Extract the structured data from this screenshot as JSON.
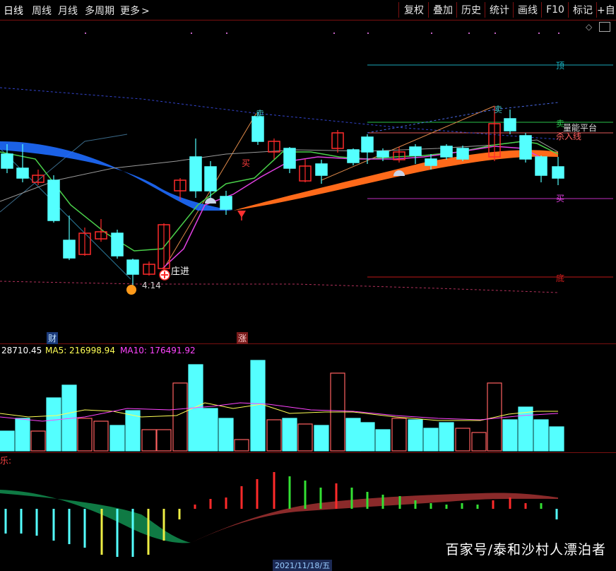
{
  "toolbar": {
    "tabs": [
      "日线",
      "周线",
      "月线",
      "多周期",
      "更多"
    ],
    "more_chevron": ">",
    "buttons": [
      "复权",
      "叠加",
      "历史",
      "统计",
      "画线",
      "F10",
      "标记",
      "+自"
    ]
  },
  "price_panel": {
    "labels": {
      "top": "顶",
      "bottom": "底",
      "sell": "卖",
      "buy": "买",
      "buy_left": "买",
      "sell_top": "卖",
      "platform": "量能平台",
      "kill_line": "杀入线",
      "low_price": "4.14",
      "banker_in": "庄进"
    },
    "event_tags": {
      "cai": "财",
      "zhang": "涨"
    }
  },
  "volume_panel": {
    "vol_text": "28710.45",
    "ma5_text": "MA5: 216998.94",
    "ma10_text": "MA10: 176491.92"
  },
  "indicator_panel": {
    "name": "乐:"
  },
  "footer": {
    "date": "2021/11/18/五",
    "watermark": "百家号/泰和沙村人漂泊者"
  },
  "colors": {
    "up": "#ff2a2a",
    "down": "#54ffff",
    "ma5": "#ffff55",
    "ma10": "#ff44ff",
    "band_blue": "#1e6bff",
    "band_orange": "#ff6a1a",
    "grid_red": "#7a1010"
  }
}
